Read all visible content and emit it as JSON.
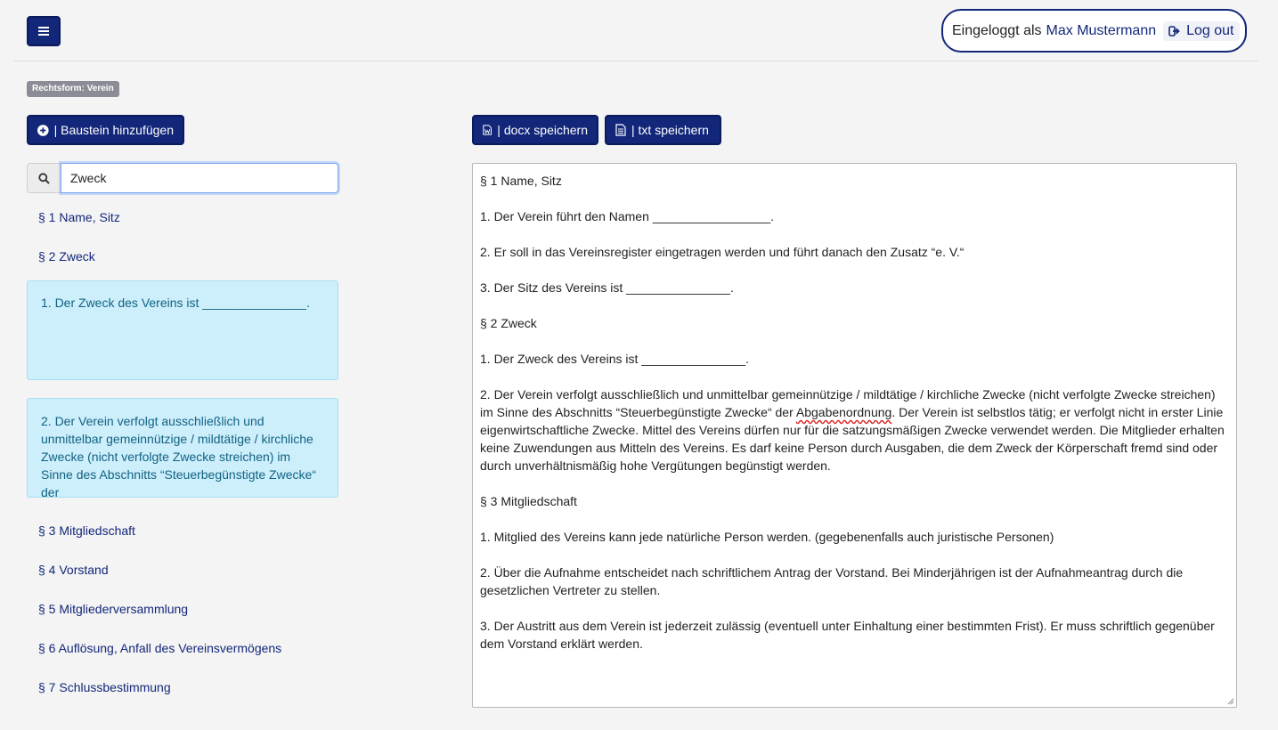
{
  "header": {
    "logged_in_prefix": "Eingeloggt als",
    "user_name": "Max Mustermann",
    "logout_label": "Log out"
  },
  "badge": "Rechtsform: Verein",
  "toolbar": {
    "add_label": "| Baustein hinzufügen",
    "docx_label": "| docx speichern",
    "txt_label": "| txt speichern"
  },
  "search": {
    "value": "Zweck"
  },
  "sidebar": {
    "sections": [
      "§ 1 Name, Sitz",
      "§ 2 Zweck",
      "§ 3 Mitgliedschaft",
      "§ 4 Vorstand",
      "§ 5 Mitgliederversammlung",
      "§ 6 Auflösung, Anfall des Vereinsvermögens",
      "§ 7 Schlussbestimmung"
    ],
    "cards": [
      "1. Der Zweck des Vereins ist _______________.",
      "2. Der Verein verfolgt ausschließlich und unmittelbar gemeinnützige / mildtätige / kirchliche Zwecke (nicht verfolgte Zwecke streichen) im Sinne des Abschnitts “Steuerbegünstigte Zwecke“ der"
    ]
  },
  "editor": {
    "lines": [
      "§ 1 Name, Sitz",
      "1. Der Verein führt den Namen _________________.",
      "2. Er soll in das Vereinsregister eingetragen werden und führt danach den Zusatz “e. V.“",
      "3. Der Sitz des Vereins ist _______________.",
      "§ 2 Zweck",
      "1. Der Zweck des Vereins ist _______________.",
      "2. Der Verein verfolgt ausschließlich und unmittelbar gemeinnützige / mildtätige / kirchliche Zwecke (nicht verfolgte Zwecke streichen) im Sinne des Abschnitts “Steuerbegünstigte Zwecke“ der",
      "Abgabenordnung",
      ". Der Verein ist selbstlos tätig; er verfolgt nicht in erster Linie eigenwirtschaftliche Zwecke. Mittel des Vereins dürfen nur für die satzungsmäßigen Zwecke verwendet werden. Die Mitglieder erhalten keine Zuwendungen aus Mitteln des Vereins. Es darf keine Person durch Ausgaben, die dem Zweck der Körperschaft fremd sind oder durch unverhältnismäßig hohe Vergütungen begünstigt werden.",
      "§ 3 Mitgliedschaft",
      "1. Mitglied des Vereins kann jede natürliche Person werden. (gegebenenfalls auch juristische Personen)",
      "2. Über die Aufnahme entscheidet nach schriftlichem Antrag der Vorstand. Bei Minderjährigen ist der Aufnahmeantrag durch die gesetzlichen Vertreter zu stellen.",
      "3. Der Austritt aus dem Verein ist jederzeit zulässig (eventuell unter Einhaltung einer bestimmten Frist). Er muss schriftlich gegenüber dem Vorstand erklärt werden."
    ]
  }
}
